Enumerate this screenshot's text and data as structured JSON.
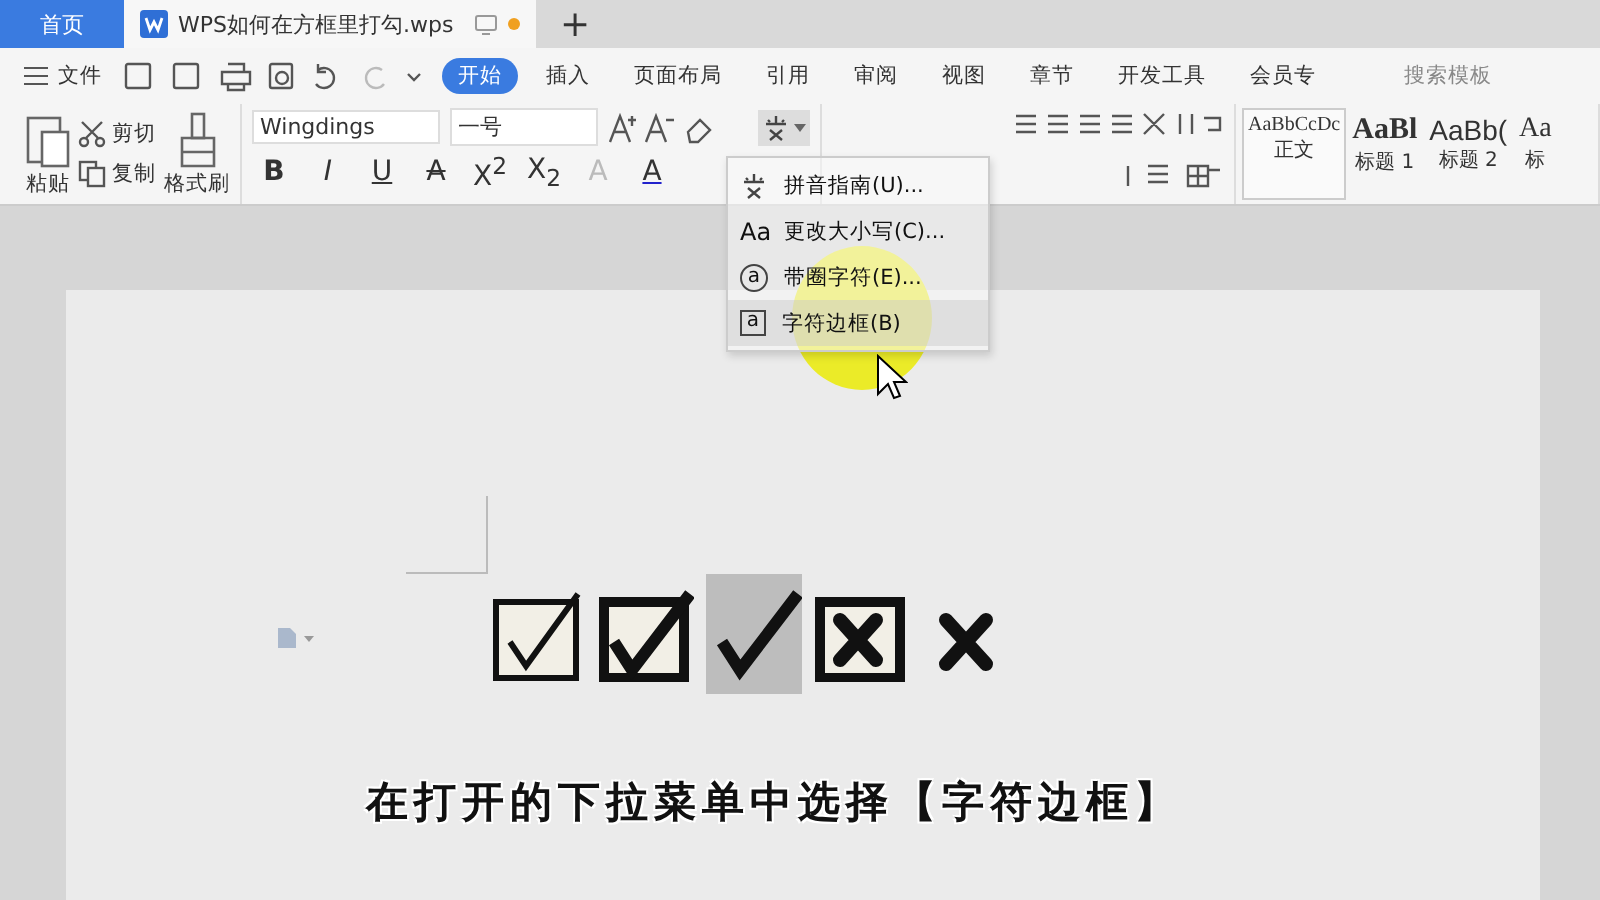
{
  "tabs": [
    {
      "label": "首页",
      "kind": "home",
      "selected": false,
      "unsaved": false
    },
    {
      "label": "WPS如何在方框里打勾.wps",
      "kind": "document",
      "selected": true,
      "unsaved": true
    }
  ],
  "new_tab": "+",
  "menu": {
    "file": "文件",
    "tabs": [
      {
        "label": "开始",
        "selected": true
      },
      {
        "label": "插入",
        "selected": false
      },
      {
        "label": "页面布局",
        "selected": false
      },
      {
        "label": "引用",
        "selected": false
      },
      {
        "label": "审阅",
        "selected": false
      },
      {
        "label": "视图",
        "selected": false
      },
      {
        "label": "章节",
        "selected": false
      },
      {
        "label": "开发工具",
        "selected": false
      },
      {
        "label": "会员专",
        "selected": false
      }
    ],
    "search": "搜索模板"
  },
  "clipboard": {
    "paste": "粘贴",
    "cut": "剪切",
    "copy": "复制",
    "painter": "格式刷"
  },
  "font": {
    "name": "Wingdings",
    "size": "一号"
  },
  "format_buttons": [
    {
      "label": "B",
      "kind": "bold"
    },
    {
      "label": "I",
      "kind": "italic"
    },
    {
      "label": "U",
      "kind": "underline"
    },
    {
      "label": "A",
      "kind": "strike"
    },
    {
      "label": "X$^{2}$",
      "kind": "plain"
    },
    {
      "label": "X$_{2}$",
      "kind": "plain"
    },
    {
      "label": "A",
      "kind": "effect"
    },
    {
      "label": "A",
      "kind": "color"
    }
  ],
  "styles": [
    {
      "preview": "AaBbCcDc",
      "label": "正文",
      "kind": "body",
      "selected": true
    },
    {
      "preview": "AaBl",
      "label": "标题 1",
      "kind": "h1",
      "selected": false
    },
    {
      "preview": "AaBb(",
      "label": "标题 2",
      "kind": "h2",
      "selected": false
    },
    {
      "preview": "Aa",
      "label": "标",
      "kind": "h3",
      "selected": false
    }
  ],
  "dropdown": [
    {
      "kind": "pinyin",
      "label": "拼音指南(U)...",
      "selected": false
    },
    {
      "kind": "case",
      "glyph": "Aa",
      "label": "更改大小写(C)...",
      "selected": false
    },
    {
      "kind": "enclose",
      "glyph": "a",
      "label": "带圈字符(E)...",
      "selected": false
    },
    {
      "kind": "border",
      "glyph": "a",
      "label": "字符边框(B)",
      "selected": true
    }
  ],
  "symbols": [
    {
      "kind": "check-box",
      "selected": false
    },
    {
      "kind": "check-box-bold",
      "selected": false
    },
    {
      "kind": "check",
      "selected": true
    },
    {
      "kind": "cross-box",
      "selected": false
    },
    {
      "kind": "cross",
      "selected": false
    }
  ],
  "caption": "在打开的下拉菜单中选择【字符边框】"
}
